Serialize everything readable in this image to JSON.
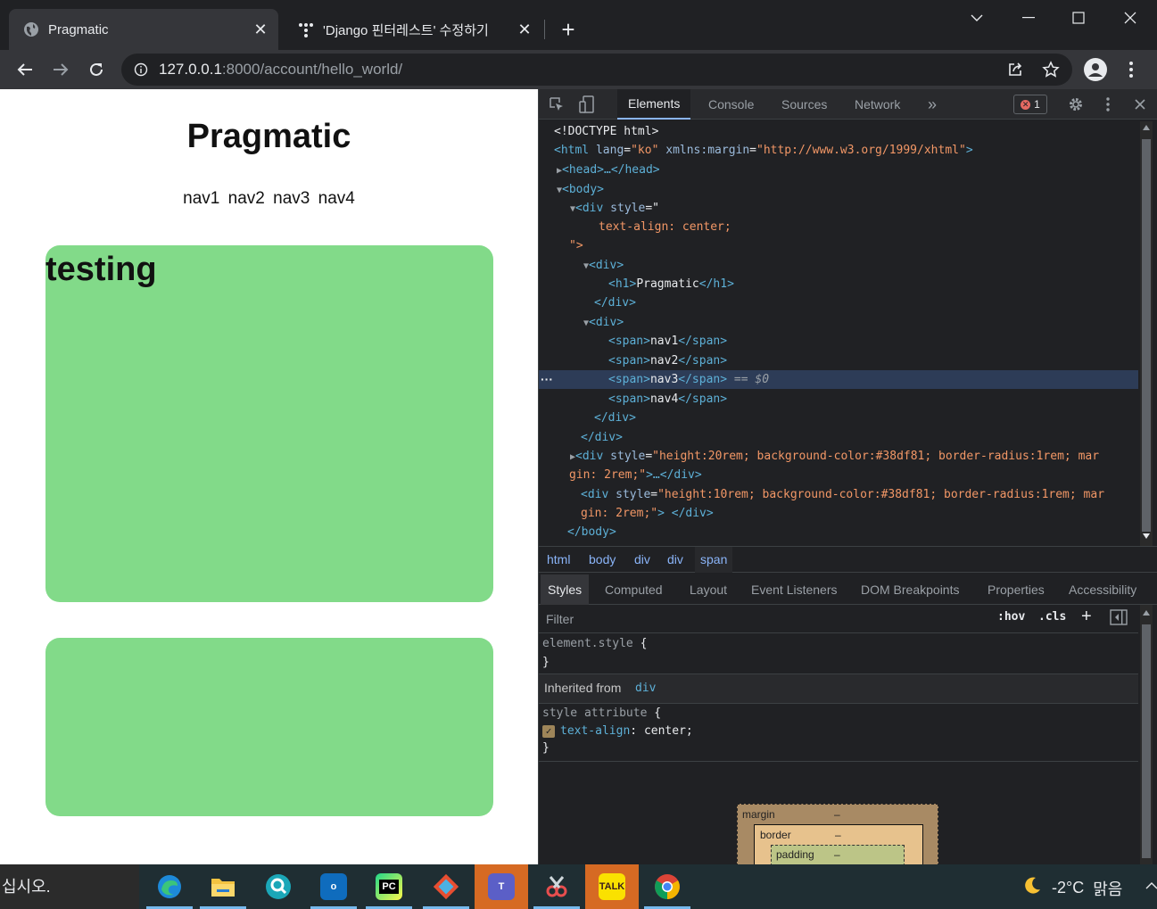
{
  "browser": {
    "tabs": [
      {
        "title": "Pragmatic",
        "active": true
      },
      {
        "title": "'Django 핀터레스트' 수정하기",
        "active": false
      }
    ],
    "address": {
      "host": "127.0.0.1",
      "rest": ":8000/account/hello_world/"
    }
  },
  "page": {
    "heading": "Pragmatic",
    "nav": [
      "nav1",
      "nav2",
      "nav3",
      "nav4"
    ],
    "box1_text": "testing",
    "box_color": "#82da89"
  },
  "devtools": {
    "tabs": [
      "Elements",
      "Console",
      "Sources",
      "Network"
    ],
    "more": "»",
    "error_count": "1",
    "dom": {
      "doctype": "<!DOCTYPE html>",
      "html_open": "<html",
      "html_lang_name": "lang",
      "html_lang_val": "\"ko\"",
      "html_xmlns_name": "xmlns:margin",
      "html_xmlns_val": "\"http://www.w3.org/1999/xhtml\"",
      "head": "<head>…</head>",
      "body_open": "<body>",
      "div_style_open": "<div",
      "style_attr": "style",
      "style_quote_open": "=\"",
      "style_val": "text-align: center;",
      "style_quote_close": "\">",
      "div_open": "<div>",
      "h1_open": "<h1>",
      "h1_text": "Pragmatic",
      "h1_close": "</h1>",
      "div_close": "</div>",
      "span_open": "<span>",
      "span_close": "</span>",
      "spans": [
        "nav1",
        "nav2",
        "nav3",
        "nav4"
      ],
      "selected_marker": "== $0",
      "box1_style": "\"height:20rem; background-color:#38df81; border-radius:1rem; mar",
      "box1_style_wrap": "gin: 2rem;\"",
      "box1_tail": ">…</div>",
      "box2_style": "\"height:10rem; background-color:#38df81; border-radius:1rem; mar",
      "box2_style_wrap": "gin: 2rem;\"",
      "box2_tail": "> </div>",
      "body_close": "</body>"
    },
    "breadcrumbs": [
      "html",
      "body",
      "div",
      "div",
      "span"
    ],
    "subtabs": [
      "Styles",
      "Computed",
      "Layout",
      "Event Listeners",
      "DOM Breakpoints",
      "Properties",
      "Accessibility"
    ],
    "filter_placeholder": "Filter",
    "hov": ":hov",
    "cls": ".cls",
    "styles": {
      "element_style": "element.style",
      "open_brace": "{",
      "close_brace": "}",
      "inherited_label": "Inherited from",
      "inherited_from": "div",
      "style_attribute": "style attribute",
      "prop_name": "text-align",
      "prop_value": "center;"
    },
    "boxmodel": {
      "margin": "margin",
      "border": "border",
      "padding": "padding",
      "dash": "–"
    }
  },
  "taskbar": {
    "search_text": "십시오.",
    "weather_temp": "-2°C",
    "weather_text": "맑음"
  }
}
